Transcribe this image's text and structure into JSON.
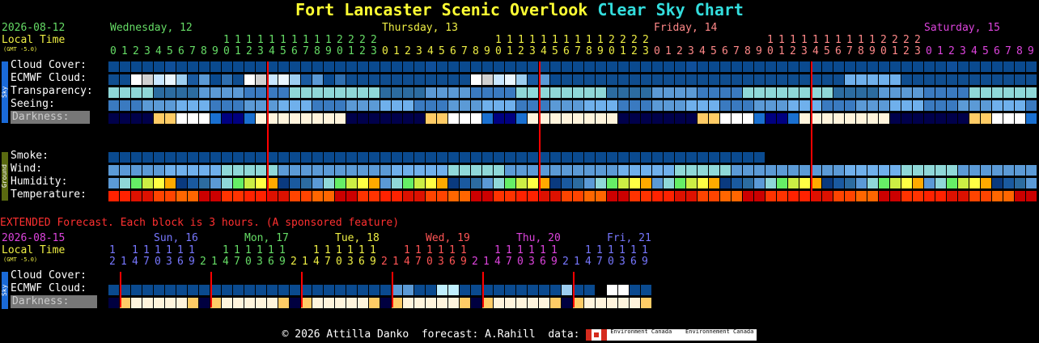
{
  "title": {
    "part1": "Fort Lancaster Scenic Overlook",
    "part2": "Clear Sky Chart"
  },
  "main": {
    "date": "2026-08-12",
    "local_time": "Local Time",
    "gmt": "(GMT -5.0)",
    "days": [
      {
        "label": "Wednesday, 12",
        "color": "#66dd66"
      },
      {
        "label": "Thursday, 13",
        "color": "#eeee44"
      },
      {
        "label": "Friday, 14",
        "color": "#ff8888"
      },
      {
        "label": "Saturday, 15",
        "color": "#dd44dd"
      }
    ],
    "start_hour": 0,
    "sky_side_label": "Sky",
    "ground_side_label": "Ground",
    "rows": {
      "cloud": "Cloud Cover:",
      "ecmwf": "ECMWF Cloud:",
      "transparency": "Transparency:",
      "seeing": "Seeing:",
      "darkness": "Darkness:",
      "smoke": "Smoke:",
      "wind": "Wind:",
      "humidity": "Humidity:",
      "temperature": "Temperature:"
    }
  },
  "extended": {
    "note": "EXTENDED Forecast. Each block is 3 hours. (A sponsored feature)",
    "date": "2026-08-15",
    "local_time": "Local Time",
    "gmt": "(GMT -5.0)",
    "days": [
      {
        "label": "Sun, 16",
        "color": "#7777ff"
      },
      {
        "label": "Mon, 17",
        "color": "#66dd66"
      },
      {
        "label": "Tue, 18",
        "color": "#eeee44"
      },
      {
        "label": "Wed, 19",
        "color": "#ff5555"
      },
      {
        "label": "Thu, 20",
        "color": "#dd44dd"
      },
      {
        "label": "Fri, 21",
        "color": "#7777ff"
      }
    ],
    "rows": {
      "cloud": "Cloud Cover:",
      "ecmwf": "ECMWF Cloud:",
      "darkness": "Darkness:"
    }
  },
  "footer": {
    "copyright": "© 2026 Attilla Danko  forecast: A.Rahill  data:",
    "logo1": "Environment Canada",
    "logo2": "Environnement Canada"
  },
  "colors": {
    "cloud_clear": "#003f7f",
    "cloud_mid": "#4f8fbf",
    "ecmwf_light": "#c0c0c0",
    "transparency": "#2c6ca0",
    "seeing": "#3a7ac0",
    "smoke": "#003f7f",
    "wind": "#4f8fcf",
    "midnight_line": "#ff0000"
  }
}
